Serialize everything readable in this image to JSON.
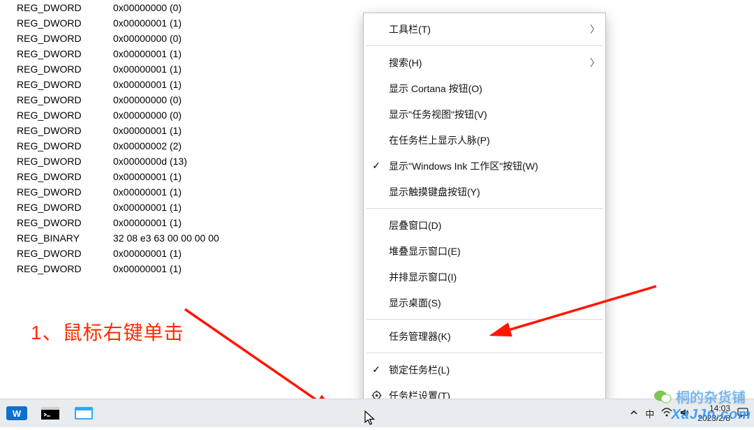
{
  "registry_rows": [
    {
      "type": "REG_DWORD",
      "value": "0x00000000 (0)"
    },
    {
      "type": "REG_DWORD",
      "value": "0x00000001 (1)"
    },
    {
      "type": "REG_DWORD",
      "value": "0x00000000 (0)"
    },
    {
      "type": "REG_DWORD",
      "value": "0x00000001 (1)"
    },
    {
      "type": "REG_DWORD",
      "value": "0x00000001 (1)"
    },
    {
      "type": "REG_DWORD",
      "value": "0x00000001 (1)"
    },
    {
      "type": "REG_DWORD",
      "value": "0x00000000 (0)"
    },
    {
      "type": "REG_DWORD",
      "value": "0x00000000 (0)"
    },
    {
      "type": "REG_DWORD",
      "value": "0x00000001 (1)"
    },
    {
      "type": "REG_DWORD",
      "value": "0x00000002 (2)"
    },
    {
      "type": "REG_DWORD",
      "value": "0x0000000d (13)"
    },
    {
      "type": "REG_DWORD",
      "value": "0x00000001 (1)"
    },
    {
      "type": "REG_DWORD",
      "value": "0x00000001 (1)"
    },
    {
      "type": "REG_DWORD",
      "value": "0x00000001 (1)"
    },
    {
      "type": "REG_DWORD",
      "value": "0x00000001 (1)"
    },
    {
      "type": "REG_BINARY",
      "value": "32 08 e3 63 00 00 00 00"
    },
    {
      "type": "REG_DWORD",
      "value": "0x00000001 (1)"
    },
    {
      "type": "REG_DWORD",
      "value": "0x00000001 (1)"
    }
  ],
  "annotation": "1、鼠标右键单击",
  "context_menu": {
    "sections": [
      [
        {
          "label": "工具栏(T)",
          "submenu": true,
          "checked": false
        }
      ],
      [
        {
          "label": "搜索(H)",
          "submenu": true,
          "checked": false
        },
        {
          "label": "显示 Cortana 按钮(O)",
          "submenu": false,
          "checked": false
        },
        {
          "label": "显示\"任务视图\"按钮(V)",
          "submenu": false,
          "checked": false
        },
        {
          "label": "在任务栏上显示人脉(P)",
          "submenu": false,
          "checked": false
        },
        {
          "label": "显示\"Windows Ink 工作区\"按钮(W)",
          "submenu": false,
          "checked": true
        },
        {
          "label": "显示触摸键盘按钮(Y)",
          "submenu": false,
          "checked": false
        }
      ],
      [
        {
          "label": "层叠窗口(D)",
          "submenu": false,
          "checked": false
        },
        {
          "label": "堆叠显示窗口(E)",
          "submenu": false,
          "checked": false
        },
        {
          "label": "并排显示窗口(I)",
          "submenu": false,
          "checked": false
        },
        {
          "label": "显示桌面(S)",
          "submenu": false,
          "checked": false
        }
      ],
      [
        {
          "label": "任务管理器(K)",
          "submenu": false,
          "checked": false
        }
      ],
      [
        {
          "label": "锁定任务栏(L)",
          "submenu": false,
          "checked": true
        },
        {
          "label": "任务栏设置(T)",
          "submenu": false,
          "checked": false,
          "icon": "gear"
        }
      ]
    ]
  },
  "taskbar": {
    "items": [
      {
        "name": "wps-icon",
        "color": "#0f6fce"
      },
      {
        "name": "terminal-icon",
        "color": "#000"
      },
      {
        "name": "browser-icon",
        "color": "#0a84ff"
      }
    ]
  },
  "tray": {
    "ime": "中",
    "wifi": "wifi-icon",
    "sound": "speaker-icon",
    "time": "14:03",
    "date": "2023/2/8"
  },
  "watermark": {
    "text": "桐的杂货铺",
    "site": "XaJJn.com"
  },
  "colors": {
    "arrow": "#ff1500",
    "menu_border": "#bfbfbf"
  }
}
